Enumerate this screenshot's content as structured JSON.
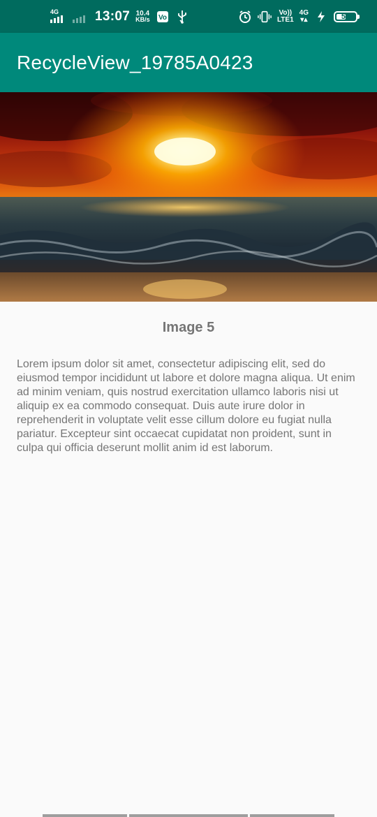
{
  "status_bar": {
    "network_1": "4G",
    "time": "13:07",
    "speed_value": "10.4",
    "speed_unit": "KB/s",
    "volte": "Vo))",
    "lte": "LTE1",
    "network_2": "4G",
    "battery_level": "51",
    "battery_fraction": 0.51,
    "icons": [
      "signal-icon",
      "signal-dim-icon",
      "app-notification-icon",
      "usb-icon",
      "alarm-icon",
      "vibrate-icon",
      "volte-icon",
      "data-arrows-icon",
      "charging-icon",
      "battery-icon"
    ]
  },
  "app_bar": {
    "title": "RecycleView_19785A0423",
    "color": "#00897b",
    "status_color": "#006b5e"
  },
  "item": {
    "image_alt": "sunset-over-sea-image",
    "title": "Image 5",
    "description": "Lorem ipsum dolor sit amet, consectetur adipiscing elit, sed do eiusmod tempor incididunt ut labore et dolore magna aliqua. Ut enim ad minim veniam, quis nostrud exercitation ullamco laboris nisi ut aliquip ex ea commodo consequat. Duis aute irure dolor in reprehenderit in voluptate velit esse cillum dolore eu fugiat nulla pariatur. Excepteur sint occaecat cupidatat non proident, sunt in culpa qui officia deserunt mollit anim id est laborum."
  }
}
